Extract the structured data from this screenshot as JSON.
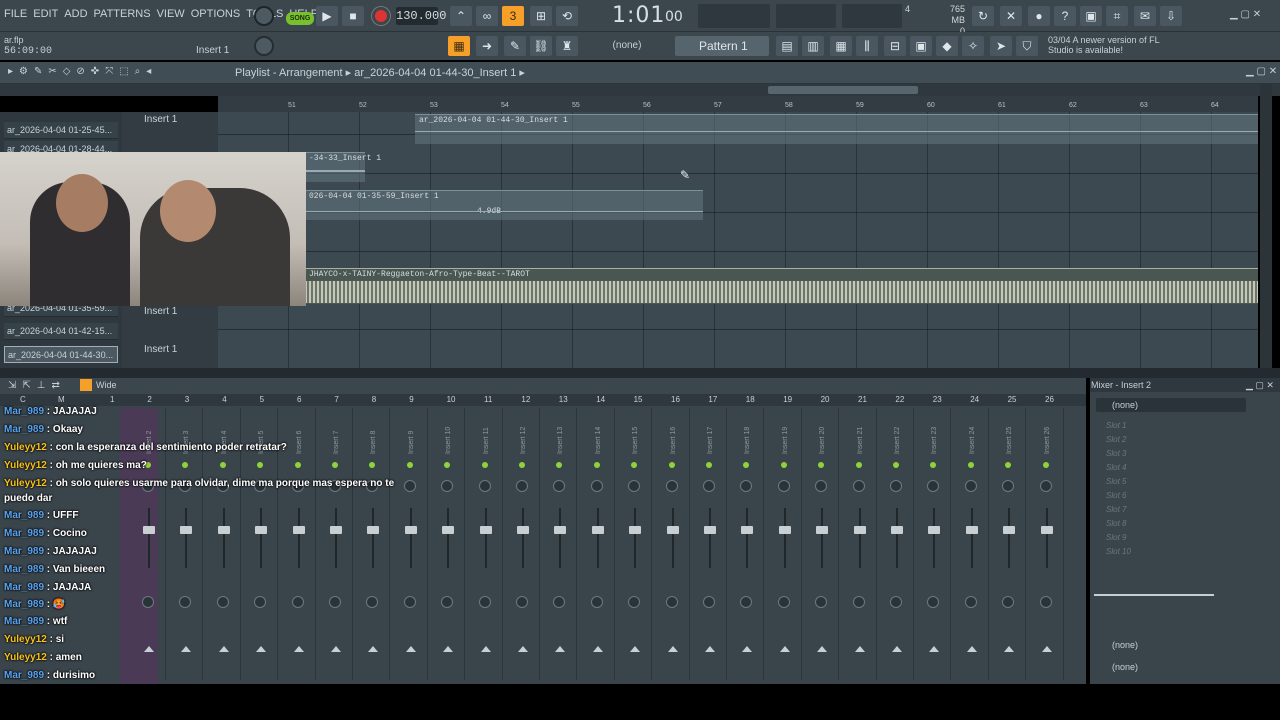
{
  "menu": [
    "FILE",
    "EDIT",
    "ADD",
    "PATTERNS",
    "VIEW",
    "OPTIONS",
    "TOOLS",
    "HELP"
  ],
  "transport": {
    "song_label": "SONG",
    "tempo": "130.000",
    "time_main": "1:01",
    "time_sub": "00"
  },
  "cpu": {
    "cores": "4",
    "memory": "765 MB",
    "voices": "0"
  },
  "hint": {
    "file": "ar.flp",
    "timestamp": "56:09:00",
    "insert": "Insert 1"
  },
  "pattern": {
    "none_label": "(none)",
    "name": "Pattern 1"
  },
  "update_notice": "03/04  A newer version of FL Studio is available!",
  "playlist": {
    "title": "Playlist - Arrangement",
    "breadcrumb": "ar_2026-04-04 01-44-30_Insert 1",
    "ruler": [
      "51",
      "52",
      "53",
      "54",
      "55",
      "56",
      "57",
      "58",
      "59",
      "60",
      "61",
      "62",
      "63",
      "64"
    ],
    "tracks": [
      "ar_2026-04-04 01-25-45...",
      "ar_2026-04-04 01-28-44...",
      "",
      "",
      "",
      "",
      "",
      "",
      "ar_2026-04-04 01-35-59...",
      "ar_2026-04-04 01-42-15...",
      "ar_2026-04-04 01-44-30..."
    ],
    "insert_labels": [
      "Insert 1",
      "Insert 1",
      "Insert 1"
    ],
    "clips": [
      {
        "label": "ar_2026-04-04 01-44-30_Insert 1"
      },
      {
        "label": "-34-33_Insert 1"
      },
      {
        "label": "026-04-04 01-35-59_Insert 1",
        "gain": "4.9dB"
      },
      {
        "label": "JHAYCO-x-TAINY-Reggaeton-Afro-Type-Beat--TAROT"
      }
    ]
  },
  "mixer": {
    "toolbar_label": "Wide",
    "header": "Mixer - Insert 2",
    "channels": [
      "C",
      "M",
      "1",
      "2",
      "3",
      "4",
      "5",
      "6",
      "7",
      "8",
      "9",
      "10",
      "11",
      "12",
      "13",
      "14",
      "15",
      "16",
      "17",
      "18",
      "19",
      "20",
      "21",
      "22",
      "23",
      "24",
      "25",
      "26"
    ],
    "strip_names": [
      "Insert 2",
      "Insert 3",
      "Insert 4",
      "Insert 5",
      "Insert 6",
      "Insert 7",
      "Insert 8",
      "Insert 9",
      "Insert 10",
      "Insert 11",
      "Insert 12",
      "Insert 13",
      "Insert 14",
      "Insert 15",
      "Insert 16",
      "Insert 17",
      "Insert 18",
      "Insert 19",
      "Insert 20",
      "Insert 21",
      "Insert 22",
      "Insert 23",
      "Insert 24",
      "Insert 25",
      "Insert 26"
    ],
    "slots": [
      "Slot 1",
      "Slot 2",
      "Slot 3",
      "Slot 4",
      "Slot 5",
      "Slot 6",
      "Slot 7",
      "Slot 8",
      "Slot 9",
      "Slot 10"
    ],
    "none_top": "(none)",
    "none_bottom1": "(none)",
    "none_bottom2": "(none)"
  },
  "chat": [
    {
      "user": "Mar_989",
      "text": "JAJAJAJ"
    },
    {
      "user": "Mar_989",
      "text": "Okaay"
    },
    {
      "user": "Yuleyy12",
      "text": "con la esperanza del sentimiento poder retratar?"
    },
    {
      "user": "Yuleyy12",
      "text": "oh me quieres ma?"
    },
    {
      "user": "Yuleyy12",
      "text": "oh solo quieres usarme para olvidar, dime ma porque mas espera no te"
    },
    {
      "user": "",
      "text": "puedo dar"
    },
    {
      "user": "Mar_989",
      "text": "UFFF"
    },
    {
      "user": "Mar_989",
      "text": "Cocino"
    },
    {
      "user": "Mar_989",
      "text": "JAJAJAJ"
    },
    {
      "user": "Mar_989",
      "text": "Van bieeen"
    },
    {
      "user": "Mar_989",
      "text": "JAJAJA"
    },
    {
      "user": "Mar_989",
      "text": "🥵"
    },
    {
      "user": "Mar_989",
      "text": "wtf"
    },
    {
      "user": "Yuleyy12",
      "text": "si"
    },
    {
      "user": "Yuleyy12",
      "text": "amen"
    },
    {
      "user": "Mar_989",
      "text": "durisimo"
    }
  ],
  "colors": {
    "accent_green": "#8ed33a",
    "accent_orange": "#f6a02a",
    "user_blue": "#58a4f0",
    "user_yellow": "#f6c21c"
  }
}
